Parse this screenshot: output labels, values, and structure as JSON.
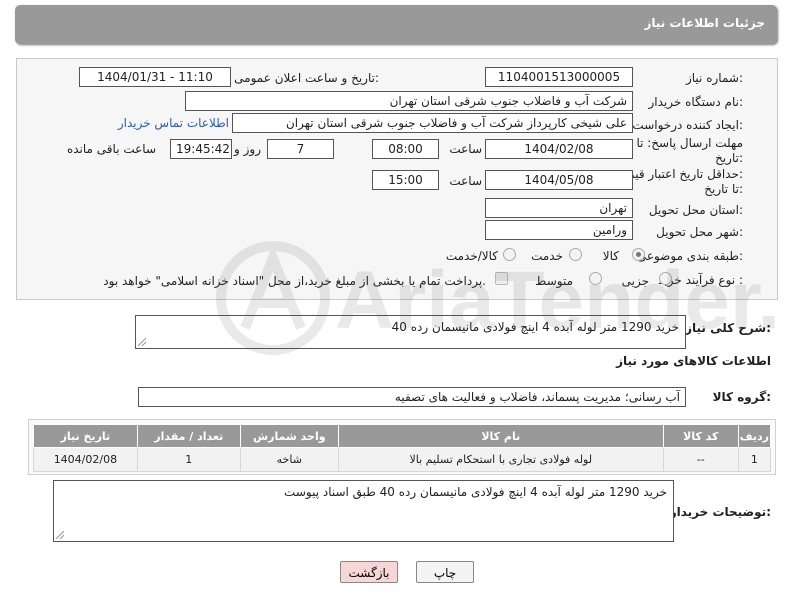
{
  "header": {
    "title": "جزئیات اطلاعات نیاز"
  },
  "form": {
    "need_number": {
      "label": "شماره نیاز:",
      "value": "1104001513000005"
    },
    "announce": {
      "label": "تاریخ و ساعت اعلان عمومی:",
      "value": "1404/01/31 - 11:10"
    },
    "buyer_org": {
      "label": "نام دستگاه خریدار:",
      "value": "شرکت آب و فاضلاب جنوب شرقی استان تهران"
    },
    "creator": {
      "label": "ایجاد کننده درخواست:",
      "value": "علی شیخی کارپرداز شرکت آب و فاضلاب جنوب شرقی استان تهران",
      "contact_link": "اطلاعات تماس خریدار"
    },
    "deadline": {
      "label_line1": "مهلت ارسال پاسخ: تا",
      "label_line2": "تاریخ:",
      "date": "1404/02/08",
      "time_label": "ساعت",
      "time": "08:00",
      "days": "7",
      "days_label": "روز و",
      "remaining": "19:45:42",
      "remaining_label": "ساعت باقی مانده"
    },
    "price_validity": {
      "label_line1": "حداقل تاریخ اعتبار قیمت:",
      "label_line2": "تا تاریخ:",
      "date": "1404/05/08",
      "time_label": "ساعت",
      "time": "15:00"
    },
    "province": {
      "label": "استان محل تحویل:",
      "value": "تهران"
    },
    "city": {
      "label": "شهر محل تحویل:",
      "value": "ورامین"
    },
    "category": {
      "label": "طبقه بندی موضوعی:",
      "options": [
        "کالا",
        "خدمت",
        "کالا/خدمت"
      ],
      "selected": "کالا"
    },
    "process": {
      "label": "نوع فرآیند خرید :",
      "options": [
        "جزیی",
        "متوسط"
      ],
      "note": "پرداخت تمام یا بخشی از مبلغ خرید،از محل \"اسناد خزانه اسلامی\" خواهد بود."
    }
  },
  "summary": {
    "label": "شرح کلی نیاز:",
    "value": "خرید 1290 متر لوله آبده 4 اینچ فولادی مانیسمان رده 40"
  },
  "goods_info": {
    "title": "اطلاعات کالاهای مورد نیاز",
    "group_label": "گروه کالا:",
    "group_value": "آب رسانی؛ مدیریت پسماند، فاضلاب و فعالیت های تصفیه"
  },
  "table": {
    "headers": [
      "ردیف",
      "کد کالا",
      "نام کالا",
      "واحد شمارش",
      "تعداد / مقدار",
      "تاریخ نیاز"
    ],
    "rows": [
      [
        "1",
        "--",
        "لوله فولادی تجاری با استحکام تسلیم بالا",
        "شاخه",
        "1",
        "1404/02/08"
      ]
    ]
  },
  "buyer_notes": {
    "label": "توضیحات خریدار:",
    "value": "خرید 1290 متر لوله آبده 4 اینچ فولادی مانیسمان رده 40 طبق اسناد پیوست"
  },
  "buttons": {
    "print": "چاپ",
    "back": "بازگشت"
  },
  "watermark": {
    "text": "AriaTender.neT"
  },
  "colors": {
    "header_bg": "#999999",
    "link": "#2a5db0",
    "back_button_bg": "#f7d6d6"
  }
}
